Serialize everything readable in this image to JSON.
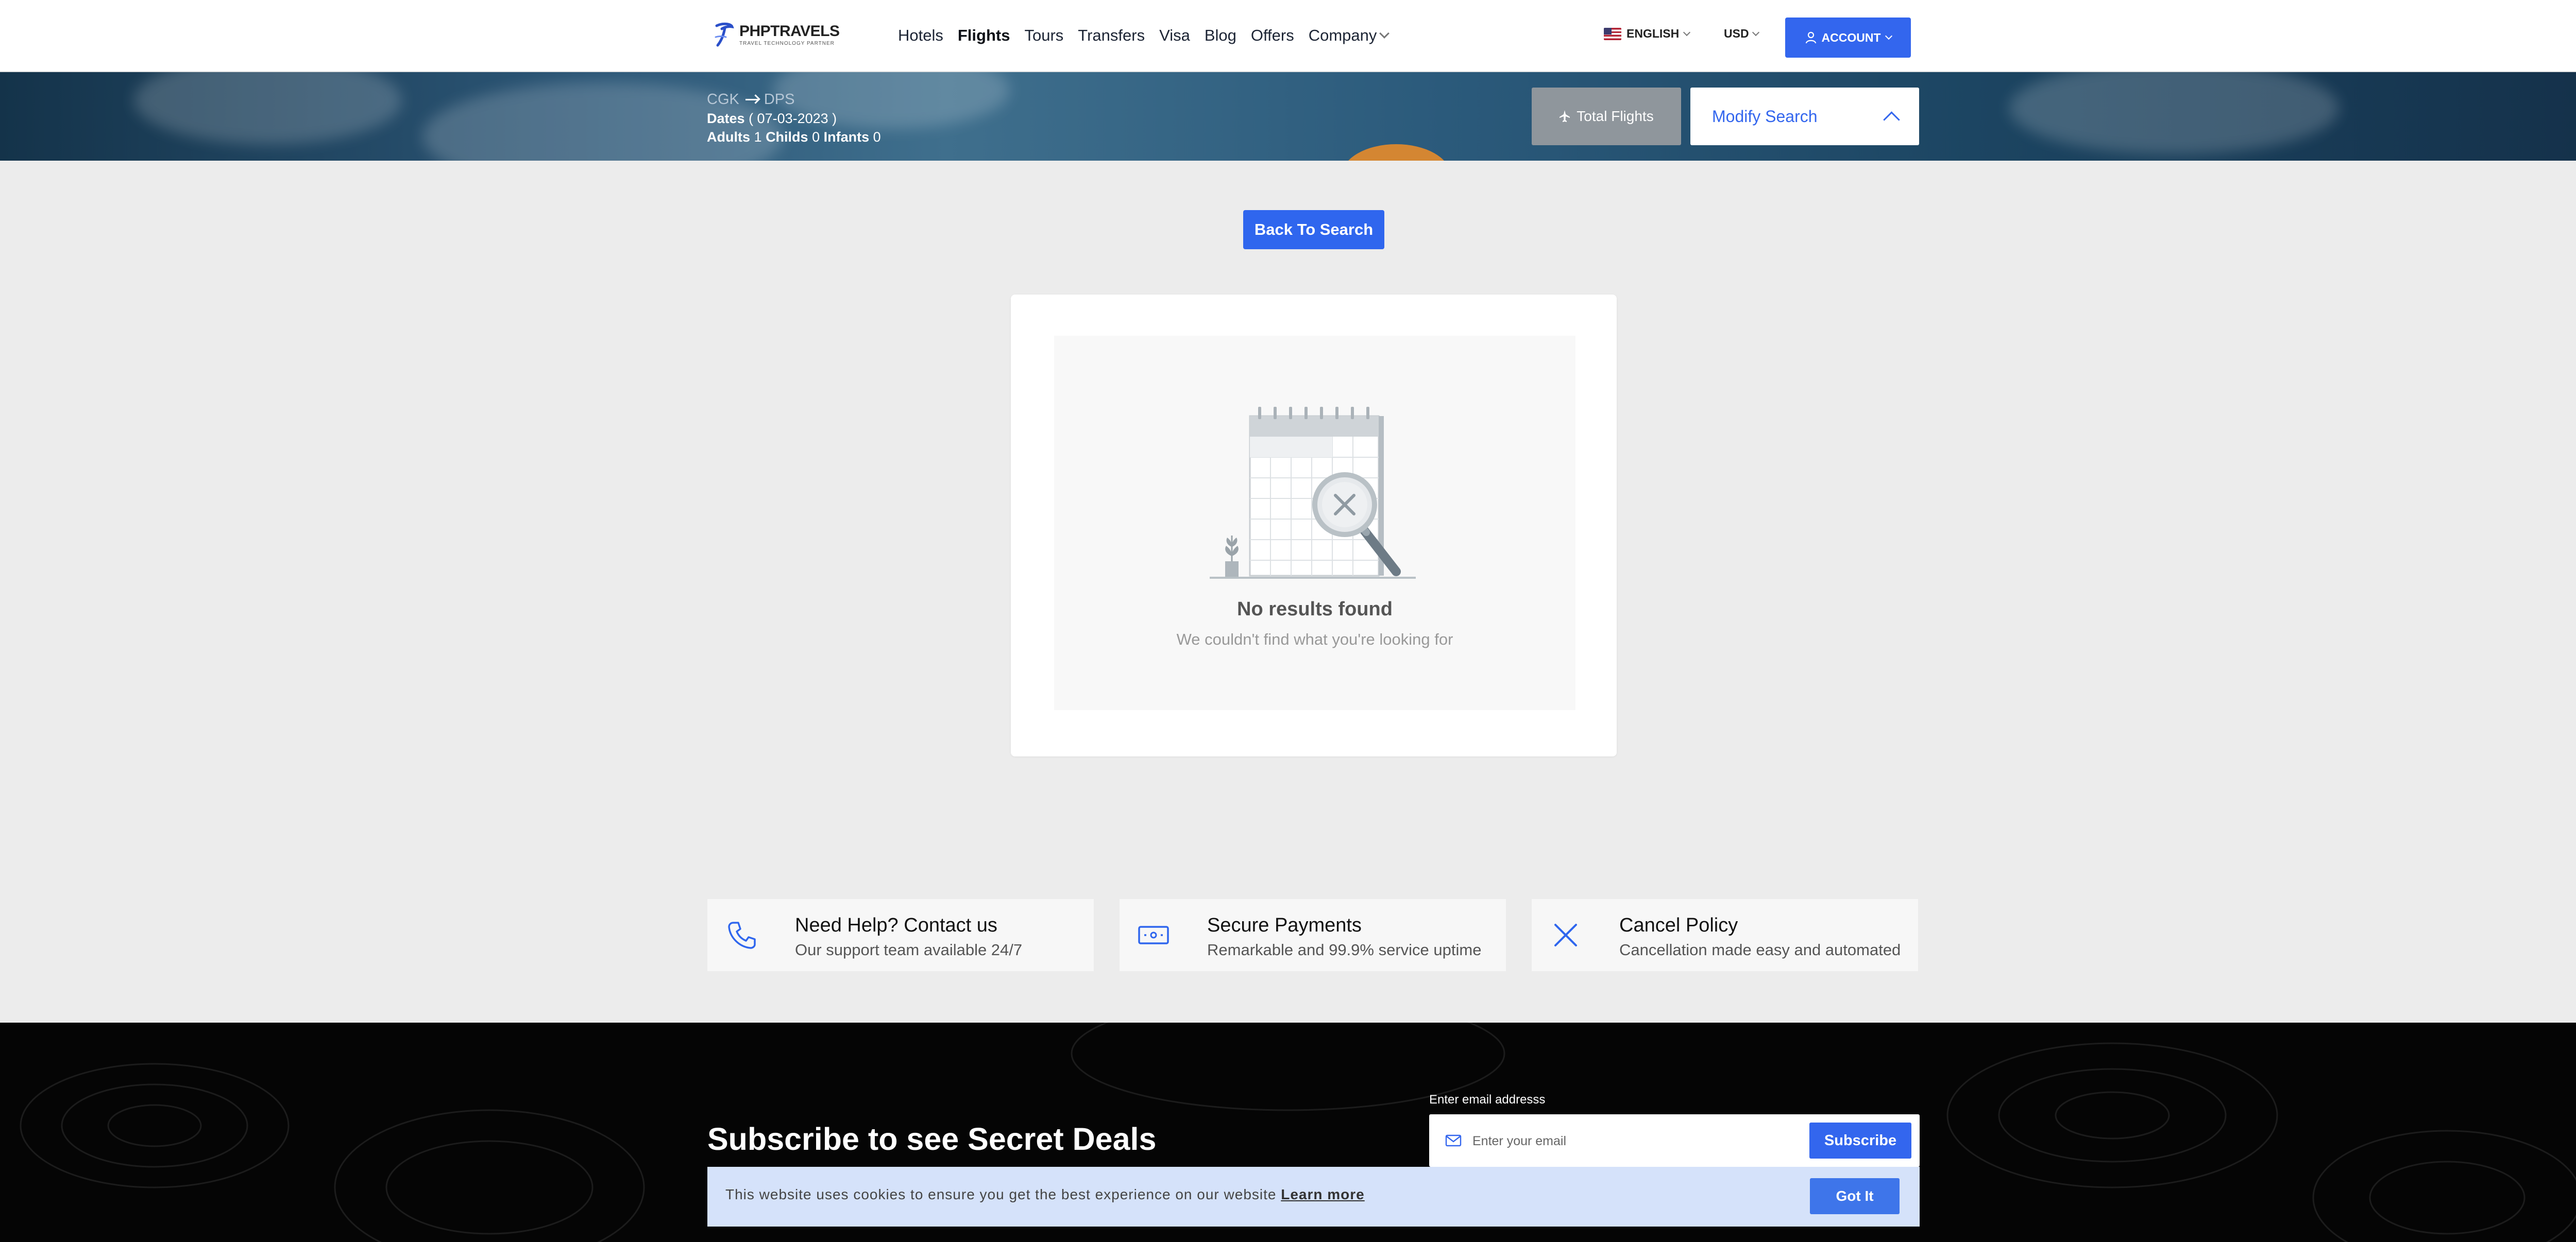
{
  "header": {
    "logo_text": "PHPTRAVELS",
    "logo_subtext": "TRAVEL TECHNOLOGY PARTNER",
    "nav": [
      {
        "label": "Hotels",
        "active": false
      },
      {
        "label": "Flights",
        "active": true
      },
      {
        "label": "Tours",
        "active": false
      },
      {
        "label": "Transfers",
        "active": false
      },
      {
        "label": "Visa",
        "active": false
      },
      {
        "label": "Blog",
        "active": false
      },
      {
        "label": "Offers",
        "active": false
      },
      {
        "label": "Company",
        "active": false
      }
    ],
    "language": "ENGLISH",
    "currency": "USD",
    "account_label": "ACCOUNT"
  },
  "search_summary": {
    "from": "CGK",
    "to": "DPS",
    "dates_label": "Dates",
    "dates_value": "( 07-03-2023 )",
    "adults_label": "Adults",
    "adults": "1",
    "childs_label": "Childs",
    "childs": "0",
    "infants_label": "Infants",
    "infants": "0",
    "total_flights_label": "Total Flights",
    "modify_search_label": "Modify Search"
  },
  "main": {
    "back_button": "Back To Search",
    "no_results_title": "No results found",
    "no_results_subtitle": "We couldn't find what you're looking for"
  },
  "features": [
    {
      "title": "Need Help? Contact us",
      "desc": "Our support team available 24/7",
      "icon": "phone-icon"
    },
    {
      "title": "Secure Payments",
      "desc": "Remarkable and 99.9% service uptime",
      "icon": "payment-icon"
    },
    {
      "title": "Cancel Policy",
      "desc": "Cancellation made easy and automated",
      "icon": "close-icon"
    }
  ],
  "footer": {
    "subscribe_title": "Subscribe to see Secret Deals",
    "email_label": "Enter email addresss",
    "email_placeholder": "Enter your email",
    "subscribe_button": "Subscribe"
  },
  "cookie": {
    "text": "This website uses cookies to ensure you get the best experience on our website",
    "learn_more": "Learn more",
    "button": "Got It"
  },
  "colors": {
    "primary": "#3366ee",
    "footer_bg": "#050505",
    "cookie_bg": "#d5e2fa"
  }
}
